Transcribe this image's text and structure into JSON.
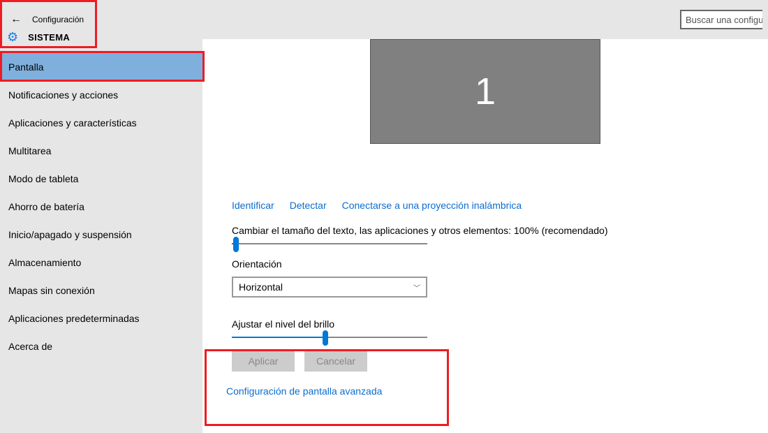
{
  "header": {
    "back": "←",
    "title": "Configuración",
    "section": "SISTEMA",
    "search_placeholder": "Buscar una configu"
  },
  "sidebar": {
    "items": [
      "Pantalla",
      "Notificaciones y acciones",
      "Aplicaciones y características",
      "Multitarea",
      "Modo de tableta",
      "Ahorro de batería",
      "Inicio/apagado y suspensión",
      "Almacenamiento",
      "Mapas sin conexión",
      "Aplicaciones predeterminadas",
      "Acerca de"
    ],
    "active_index": 0
  },
  "main": {
    "monitor_number": "1",
    "links": {
      "identify": "Identificar",
      "detect": "Detectar",
      "wireless": "Conectarse a una proyección inalámbrica"
    },
    "scale": {
      "label": "Cambiar el tamaño del texto, las aplicaciones y otros elementos: 100% (recomendado)",
      "value_pct": 2
    },
    "orientation": {
      "label": "Orientación",
      "value": "Horizontal"
    },
    "brightness": {
      "label": "Ajustar el nivel del brillo",
      "value_pct": 48
    },
    "buttons": {
      "apply": "Aplicar",
      "cancel": "Cancelar"
    },
    "advanced_link": "Configuración de pantalla avanzada"
  }
}
